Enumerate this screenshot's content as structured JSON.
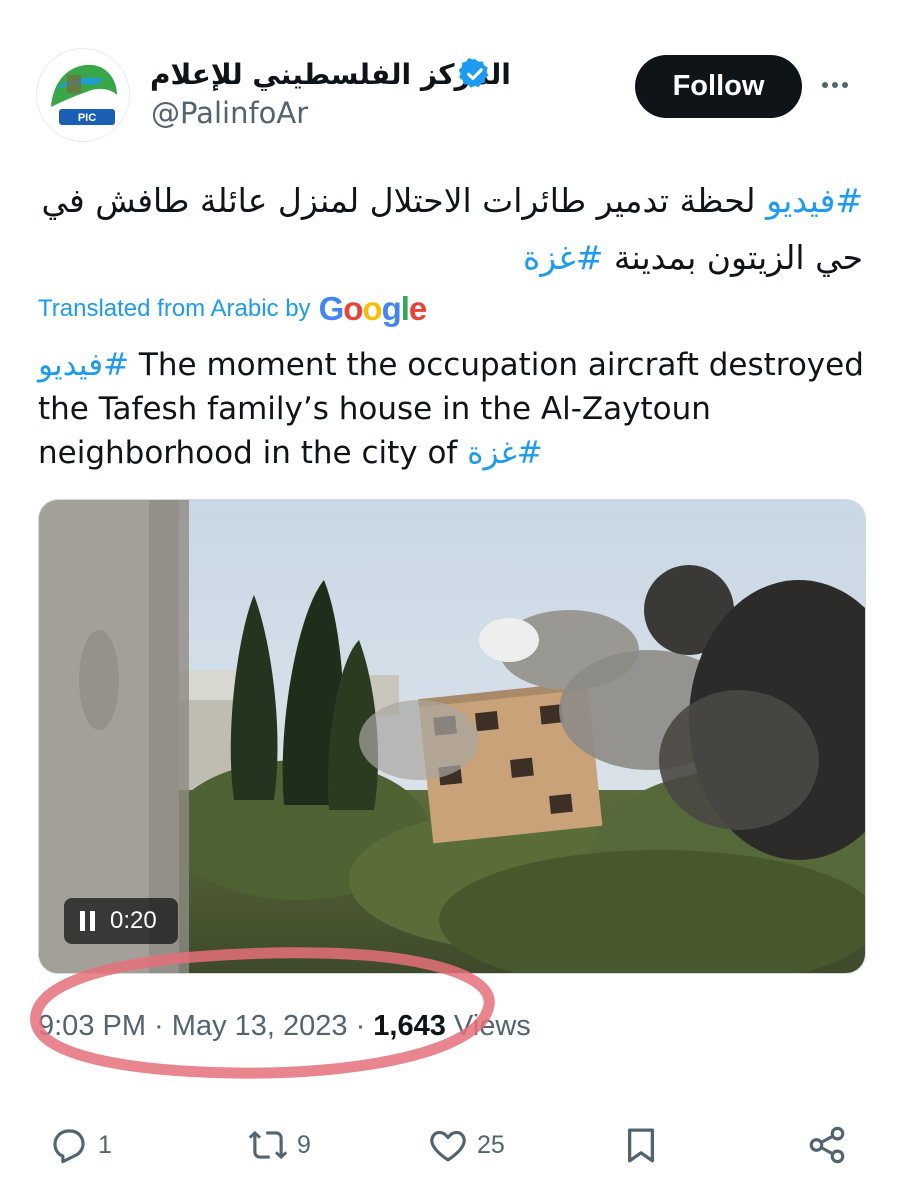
{
  "header": {
    "account_name": "المركز الفلسطيني للإعلام",
    "handle": "@PalinfoAr",
    "follow_label": "Follow",
    "avatar_icon": "palinfo-logo-icon",
    "verified_icon": "verified-badge-icon",
    "more_icon": "more-dots-icon"
  },
  "tweet": {
    "hashtag_1": "#فيديو",
    "arabic_line_1": " لحظة تدمير طائرات الاحتلال لمنزل عائلة طافش في",
    "arabic_line_2": "حي الزيتون بمدينة ",
    "hashtag_2": "#غزة",
    "translated_from": "Translated from Arabic by",
    "google": "Google",
    "translation_hashtag_1": "فيديو#",
    "translation_text": " The moment the occupation aircraft destroyed the Tafesh family’s house in the Al-Zaytoun neighborhood in the city of ",
    "translation_hashtag_2": "غزة#"
  },
  "media": {
    "duration": "0:20",
    "pause_icon": "pause-icon"
  },
  "meta": {
    "time": "9:03 PM",
    "separator": " · ",
    "date": "May 13, 2023",
    "views_count": "1,643",
    "views_label": " Views"
  },
  "actions": {
    "replies": "1",
    "reposts": "9",
    "likes": "25"
  },
  "colors": {
    "accent": "#1d9bf0",
    "annotation": "#e5707a"
  }
}
